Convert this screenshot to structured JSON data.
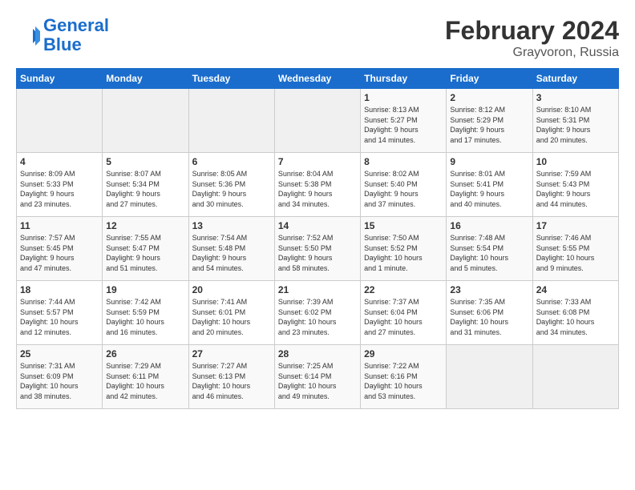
{
  "header": {
    "logo_line1": "General",
    "logo_line2": "Blue",
    "month": "February 2024",
    "location": "Grayvoron, Russia"
  },
  "days_of_week": [
    "Sunday",
    "Monday",
    "Tuesday",
    "Wednesday",
    "Thursday",
    "Friday",
    "Saturday"
  ],
  "weeks": [
    [
      {
        "day": "",
        "info": ""
      },
      {
        "day": "",
        "info": ""
      },
      {
        "day": "",
        "info": ""
      },
      {
        "day": "",
        "info": ""
      },
      {
        "day": "1",
        "info": "Sunrise: 8:13 AM\nSunset: 5:27 PM\nDaylight: 9 hours\nand 14 minutes."
      },
      {
        "day": "2",
        "info": "Sunrise: 8:12 AM\nSunset: 5:29 PM\nDaylight: 9 hours\nand 17 minutes."
      },
      {
        "day": "3",
        "info": "Sunrise: 8:10 AM\nSunset: 5:31 PM\nDaylight: 9 hours\nand 20 minutes."
      }
    ],
    [
      {
        "day": "4",
        "info": "Sunrise: 8:09 AM\nSunset: 5:33 PM\nDaylight: 9 hours\nand 23 minutes."
      },
      {
        "day": "5",
        "info": "Sunrise: 8:07 AM\nSunset: 5:34 PM\nDaylight: 9 hours\nand 27 minutes."
      },
      {
        "day": "6",
        "info": "Sunrise: 8:05 AM\nSunset: 5:36 PM\nDaylight: 9 hours\nand 30 minutes."
      },
      {
        "day": "7",
        "info": "Sunrise: 8:04 AM\nSunset: 5:38 PM\nDaylight: 9 hours\nand 34 minutes."
      },
      {
        "day": "8",
        "info": "Sunrise: 8:02 AM\nSunset: 5:40 PM\nDaylight: 9 hours\nand 37 minutes."
      },
      {
        "day": "9",
        "info": "Sunrise: 8:01 AM\nSunset: 5:41 PM\nDaylight: 9 hours\nand 40 minutes."
      },
      {
        "day": "10",
        "info": "Sunrise: 7:59 AM\nSunset: 5:43 PM\nDaylight: 9 hours\nand 44 minutes."
      }
    ],
    [
      {
        "day": "11",
        "info": "Sunrise: 7:57 AM\nSunset: 5:45 PM\nDaylight: 9 hours\nand 47 minutes."
      },
      {
        "day": "12",
        "info": "Sunrise: 7:55 AM\nSunset: 5:47 PM\nDaylight: 9 hours\nand 51 minutes."
      },
      {
        "day": "13",
        "info": "Sunrise: 7:54 AM\nSunset: 5:48 PM\nDaylight: 9 hours\nand 54 minutes."
      },
      {
        "day": "14",
        "info": "Sunrise: 7:52 AM\nSunset: 5:50 PM\nDaylight: 9 hours\nand 58 minutes."
      },
      {
        "day": "15",
        "info": "Sunrise: 7:50 AM\nSunset: 5:52 PM\nDaylight: 10 hours\nand 1 minute."
      },
      {
        "day": "16",
        "info": "Sunrise: 7:48 AM\nSunset: 5:54 PM\nDaylight: 10 hours\nand 5 minutes."
      },
      {
        "day": "17",
        "info": "Sunrise: 7:46 AM\nSunset: 5:55 PM\nDaylight: 10 hours\nand 9 minutes."
      }
    ],
    [
      {
        "day": "18",
        "info": "Sunrise: 7:44 AM\nSunset: 5:57 PM\nDaylight: 10 hours\nand 12 minutes."
      },
      {
        "day": "19",
        "info": "Sunrise: 7:42 AM\nSunset: 5:59 PM\nDaylight: 10 hours\nand 16 minutes."
      },
      {
        "day": "20",
        "info": "Sunrise: 7:41 AM\nSunset: 6:01 PM\nDaylight: 10 hours\nand 20 minutes."
      },
      {
        "day": "21",
        "info": "Sunrise: 7:39 AM\nSunset: 6:02 PM\nDaylight: 10 hours\nand 23 minutes."
      },
      {
        "day": "22",
        "info": "Sunrise: 7:37 AM\nSunset: 6:04 PM\nDaylight: 10 hours\nand 27 minutes."
      },
      {
        "day": "23",
        "info": "Sunrise: 7:35 AM\nSunset: 6:06 PM\nDaylight: 10 hours\nand 31 minutes."
      },
      {
        "day": "24",
        "info": "Sunrise: 7:33 AM\nSunset: 6:08 PM\nDaylight: 10 hours\nand 34 minutes."
      }
    ],
    [
      {
        "day": "25",
        "info": "Sunrise: 7:31 AM\nSunset: 6:09 PM\nDaylight: 10 hours\nand 38 minutes."
      },
      {
        "day": "26",
        "info": "Sunrise: 7:29 AM\nSunset: 6:11 PM\nDaylight: 10 hours\nand 42 minutes."
      },
      {
        "day": "27",
        "info": "Sunrise: 7:27 AM\nSunset: 6:13 PM\nDaylight: 10 hours\nand 46 minutes."
      },
      {
        "day": "28",
        "info": "Sunrise: 7:25 AM\nSunset: 6:14 PM\nDaylight: 10 hours\nand 49 minutes."
      },
      {
        "day": "29",
        "info": "Sunrise: 7:22 AM\nSunset: 6:16 PM\nDaylight: 10 hours\nand 53 minutes."
      },
      {
        "day": "",
        "info": ""
      },
      {
        "day": "",
        "info": ""
      }
    ]
  ]
}
